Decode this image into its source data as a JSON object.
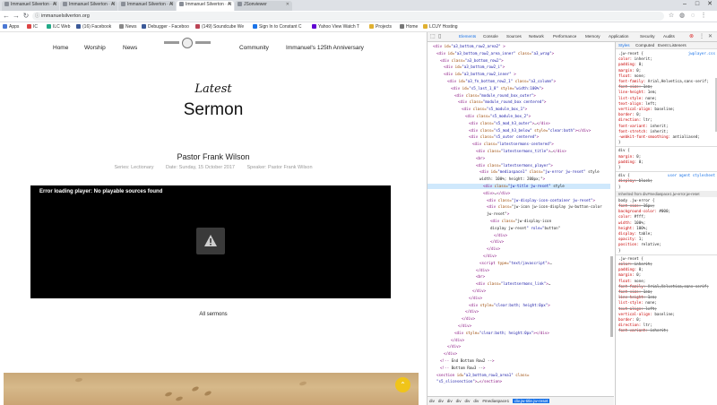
{
  "browser": {
    "tabs": [
      {
        "title": "Immanuel Silverton · Al"
      },
      {
        "title": "Immanuel Silverton · Al"
      },
      {
        "title": "Immanuel Silverton · Al"
      },
      {
        "title": "Immanuel Silverton · Al"
      },
      {
        "title": "JSonviewer"
      }
    ],
    "url": "immanuelsilverton.org",
    "bookmarks": [
      {
        "label": "Apps",
        "color": "#4a77d4"
      },
      {
        "label": "IC",
        "color": "#d44"
      },
      {
        "label": "ILC Web",
        "color": "#2a8"
      },
      {
        "label": "(16) Facebook",
        "color": "#3b5998"
      },
      {
        "label": "News",
        "color": "#888"
      },
      {
        "label": "Debugger - Faceboo",
        "color": "#3b5998"
      },
      {
        "label": "(149) Soundcube We",
        "color": "#b45"
      },
      {
        "label": "Sign In to Constant C",
        "color": "#1a73e8"
      },
      {
        "label": "Yahoo View Watch T",
        "color": "#6001d2"
      },
      {
        "label": "Projects",
        "color": "#e0b030"
      },
      {
        "label": "Home",
        "color": "#777"
      },
      {
        "label": "LCUY Hosting",
        "color": "#e0b030"
      }
    ]
  },
  "site": {
    "nav": {
      "home": "Home",
      "worship": "Worship",
      "news": "News",
      "community": "Community",
      "anniversary": "Immanuel's 125th Anniversary"
    },
    "heading_small": "Latest",
    "heading_big": "Sermon",
    "preacher": "Pastor Frank Wilson",
    "meta": {
      "series": "Series: Lectionary",
      "date": "Date: Sunday, 15 October 2017",
      "speaker": "Speaker: Pastor Frank Wilson"
    },
    "player_error": "Error loading player: No playable sources found",
    "all_sermons": "All sermons",
    "scroll_top_icon": "chevron-up-icon"
  },
  "devtools": {
    "tabs": [
      "Elements",
      "Console",
      "Sources",
      "Network",
      "Performance",
      "Memory",
      "Application",
      "Security",
      "Audits"
    ],
    "active_tab": "Elements",
    "dom_lines": [
      {
        "indent": 0,
        "html": "<div id=\"a3_bottom_row2_area2\" >",
        "sel": false
      },
      {
        "indent": 1,
        "html": "<div id=\"a3_bottom_row2_area_inner\" class=\"a3_wrap\">",
        "sel": false
      },
      {
        "indent": 2,
        "html": "<div class=\"a3_bottom_row2\">",
        "sel": false
      },
      {
        "indent": 3,
        "html": "<div id=\"a3_bottom_row2_i\">",
        "sel": false
      },
      {
        "indent": 3,
        "html": "<div id=\"a3_bottom_row2_inner\" >",
        "sel": false
      },
      {
        "indent": 4,
        "html": "<div id=\"a3_fn_bottom_row2_1\" class=\"a3_column\">",
        "sel": false
      },
      {
        "indent": 5,
        "html": "<div id=\"s5_last_1_8\" style=\"width:100%\">",
        "sel": false
      },
      {
        "indent": 6,
        "html": "<div class=\"module_round_box_outer\">",
        "sel": false
      },
      {
        "indent": 7,
        "html": "<div class=\"module_round_box centered\">",
        "sel": false
      },
      {
        "indent": 8,
        "html": "<div class=\"s5_module_box_1\">",
        "sel": false
      },
      {
        "indent": 9,
        "html": "<div class=\"s5_module_box_2\">",
        "sel": false
      },
      {
        "indent": 10,
        "html": "<div class=\"s5_mod_h3_outer\">…</div>",
        "sel": false
      },
      {
        "indent": 10,
        "html": "<div class=\"s5_mod_h3_below\" style=\"clear:both\"></div>",
        "sel": false
      },
      {
        "indent": 10,
        "html": "<div class=\"s5_outer centered\">",
        "sel": false
      },
      {
        "indent": 11,
        "html": "<div class=\"latestsermons-centered\">",
        "sel": false
      },
      {
        "indent": 12,
        "html": "<div class=\"latestsermons_title\">…</div>",
        "sel": false
      },
      {
        "indent": 12,
        "html": "<br>",
        "sel": false
      },
      {
        "indent": 12,
        "html": "<div class=\"latestsermons_player\">",
        "sel": false
      },
      {
        "indent": 13,
        "html": "<div id=\"mediaspace1\" class=\"jw-error jw-reset\" style",
        "sel": false
      },
      {
        "indent": 13,
        "html": "width: 100%; height: 200px;\">",
        "sel": false
      },
      {
        "indent": 14,
        "html": "<div class=\"jw-title jw-reset\" style",
        "sel": true
      },
      {
        "indent": 14,
        "html": "<div>…</div>",
        "sel": false
      },
      {
        "indent": 15,
        "html": "<div class=\"jw-display-icon-container jw-reset\">",
        "sel": false
      },
      {
        "indent": 15,
        "html": "<div class=\"jw-icon jw-icon-display jw-button-color",
        "sel": false
      },
      {
        "indent": 15,
        "html": "jw-reset\">",
        "sel": false
      },
      {
        "indent": 16,
        "html": "<div class=\"jw-display-icon",
        "sel": false
      },
      {
        "indent": 16,
        "html": "display jw-reset\" role=\"button\"",
        "sel": false
      },
      {
        "indent": 17,
        "html": "</div>",
        "sel": false
      },
      {
        "indent": 16,
        "html": "</div>",
        "sel": false
      },
      {
        "indent": 15,
        "html": "</div>",
        "sel": false
      },
      {
        "indent": 14,
        "html": "</div>",
        "sel": false
      },
      {
        "indent": 13,
        "html": "<script type=\"text/javascript\">…",
        "sel": false
      },
      {
        "indent": 12,
        "html": "</div>",
        "sel": false
      },
      {
        "indent": 12,
        "html": "<br>",
        "sel": false
      },
      {
        "indent": 12,
        "html": "<div class=\"latestsermons_link\">…",
        "sel": false
      },
      {
        "indent": 11,
        "html": "</div>",
        "sel": false
      },
      {
        "indent": 10,
        "html": "</div>",
        "sel": false
      },
      {
        "indent": 10,
        "html": "<div style=\"clear:both; height:0px\">",
        "sel": false
      },
      {
        "indent": 9,
        "html": "</div>",
        "sel": false
      },
      {
        "indent": 8,
        "html": "</div>",
        "sel": false
      },
      {
        "indent": 7,
        "html": "</div>",
        "sel": false
      },
      {
        "indent": 6,
        "html": "<div style=\"clear:both; height:0px\"></div>",
        "sel": false
      },
      {
        "indent": 5,
        "html": "</div>",
        "sel": false
      },
      {
        "indent": 4,
        "html": "</div>",
        "sel": false
      },
      {
        "indent": 3,
        "html": "</div>",
        "sel": false
      },
      {
        "indent": 2,
        "html": "<!-- End Bottom Row2 -->",
        "sel": false
      },
      {
        "indent": 2,
        "html": "<!-- Bottom Row3 -->",
        "sel": false
      },
      {
        "indent": 1,
        "html": "<section id=\"a3_bottom_row3_area1\" class=",
        "sel": false
      },
      {
        "indent": 1,
        "html": "\"s5_slicesection\">…</section>",
        "sel": false
      }
    ],
    "breadcrumb": [
      "div",
      "div",
      "div",
      "div",
      "div",
      "div",
      "#mediaspace1",
      "div.jw-title.jw-reset"
    ],
    "styles_tabs": [
      "Styles",
      "Computed",
      "Event Listeners"
    ],
    "styles": {
      "filter_placeholder": "Filter",
      "rule1_selector": ".jw-reset {",
      "rule1_props": [
        {
          "name": "color",
          "value": "inherit;",
          "strike": false
        },
        {
          "name": "padding",
          "value": "0;",
          "strike": false
        },
        {
          "name": "margin",
          "value": "0;",
          "strike": false
        },
        {
          "name": "float",
          "value": "none;",
          "strike": false
        },
        {
          "name": "font-family",
          "value": "Arial,Helvetica,sans-serif;",
          "strike": false
        },
        {
          "name": "font-size",
          "value": "1em;",
          "strike": true
        },
        {
          "name": "line-height",
          "value": "1em;",
          "strike": false
        },
        {
          "name": "list-style",
          "value": "none;",
          "strike": false
        },
        {
          "name": "text-align",
          "value": "left;",
          "strike": false
        },
        {
          "name": "vertical-align",
          "value": "baseline;",
          "strike": false
        },
        {
          "name": "border",
          "value": "0;",
          "strike": false
        },
        {
          "name": "direction",
          "value": "ltr;",
          "strike": false
        },
        {
          "name": "font-variant",
          "value": "inherit;",
          "strike": false
        },
        {
          "name": "font-stretch",
          "value": "inherit;",
          "strike": false
        },
        {
          "name": "-webkit-font-smoothing",
          "value": "antialiased;",
          "strike": false
        }
      ],
      "rule1_source": "jwplayer.css",
      "rule2_selector": "div {",
      "rule2_props": [
        {
          "name": "margin",
          "value": "0;",
          "strike": false
        },
        {
          "name": "padding",
          "value": "0;",
          "strike": false
        }
      ],
      "rule3_selector": "div {",
      "rule3_source": "user agent stylesheet",
      "rule3_props": [
        {
          "name": "display",
          "value": "block;",
          "strike": true
        }
      ],
      "inherited_header": "Inherited from div#mediaspace1.jw-error.jw-reset",
      "rule4_selector": "body .jw-error {",
      "rule4_props": [
        {
          "name": "font-size",
          "value": "16px;",
          "strike": true
        },
        {
          "name": "background-color",
          "value": "#000;",
          "strike": false
        },
        {
          "name": "color",
          "value": "#fff;",
          "strike": false
        },
        {
          "name": "width",
          "value": "100%;",
          "strike": false
        },
        {
          "name": "height",
          "value": "100%;",
          "strike": false
        },
        {
          "name": "display",
          "value": "table;",
          "strike": false
        },
        {
          "name": "opacity",
          "value": "1;",
          "strike": false
        },
        {
          "name": "position",
          "value": "relative;",
          "strike": false
        }
      ],
      "rule5_selector": ".jw-reset {",
      "rule5_props": [
        {
          "name": "color",
          "value": "inherit;",
          "strike": true
        },
        {
          "name": "padding",
          "value": "0;",
          "strike": false
        },
        {
          "name": "margin",
          "value": "0;",
          "strike": false
        },
        {
          "name": "float",
          "value": "none;",
          "strike": false
        },
        {
          "name": "font-family",
          "value": "Arial,Helvetica,sans-serif;",
          "strike": true
        },
        {
          "name": "font-size",
          "value": "1em;",
          "strike": true
        },
        {
          "name": "line-height",
          "value": "1em;",
          "strike": true
        },
        {
          "name": "list-style",
          "value": "none;",
          "strike": false
        },
        {
          "name": "text-align",
          "value": "left;",
          "strike": true
        },
        {
          "name": "vertical-align",
          "value": "baseline;",
          "strike": false
        },
        {
          "name": "border",
          "value": "0;",
          "strike": false
        },
        {
          "name": "direction",
          "value": "ltr;",
          "strike": false
        },
        {
          "name": "font-variant",
          "value": "inherit;",
          "strike": true
        }
      ]
    }
  }
}
